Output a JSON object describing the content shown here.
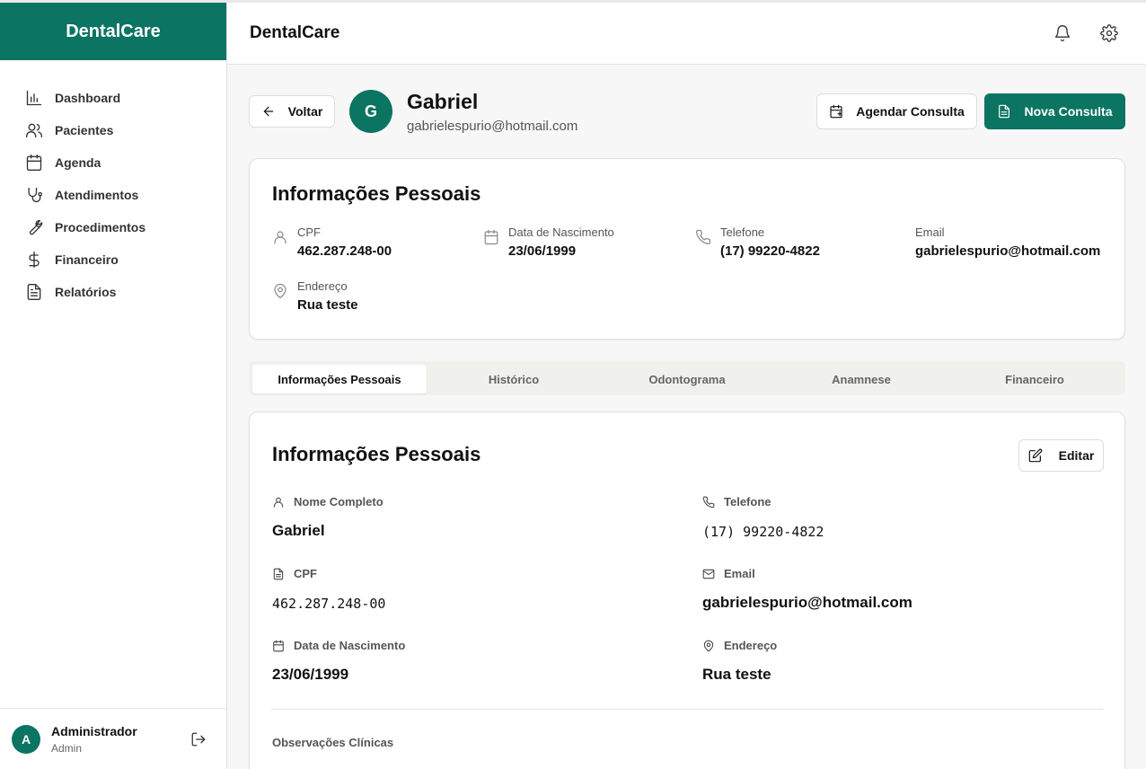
{
  "sidebar": {
    "brand": "DentalCare",
    "items": [
      {
        "label": "Dashboard",
        "icon": "chart-icon"
      },
      {
        "label": "Pacientes",
        "icon": "users-icon"
      },
      {
        "label": "Agenda",
        "icon": "calendar-icon"
      },
      {
        "label": "Atendimentos",
        "icon": "stethoscope-icon"
      },
      {
        "label": "Procedimentos",
        "icon": "wrench-icon"
      },
      {
        "label": "Financeiro",
        "icon": "dollar-icon"
      },
      {
        "label": "Relatórios",
        "icon": "file-icon"
      }
    ],
    "user": {
      "initial": "A",
      "name": "Administrador",
      "role": "Admin"
    }
  },
  "header": {
    "title": "DentalCare"
  },
  "patient": {
    "back_label": "Voltar",
    "initial": "G",
    "name": "Gabriel",
    "email": "gabrielespurio@hotmail.com",
    "schedule_label": "Agendar Consulta",
    "new_label": "Nova Consulta"
  },
  "summary": {
    "title": "Informações Pessoais",
    "fields": {
      "cpf": {
        "label": "CPF",
        "value": "462.287.248-00"
      },
      "birth": {
        "label": "Data de Nascimento",
        "value": "23/06/1999"
      },
      "phone": {
        "label": "Telefone",
        "value": "(17) 99220-4822"
      },
      "email": {
        "label": "Email",
        "value": "gabrielespurio@hotmail.com"
      },
      "address": {
        "label": "Endereço",
        "value": "Rua teste"
      }
    }
  },
  "tabs": [
    "Informações Pessoais",
    "Histórico",
    "Odontograma",
    "Anamnese",
    "Financeiro"
  ],
  "details": {
    "title": "Informações Pessoais",
    "edit_label": "Editar",
    "fields": {
      "name": {
        "label": "Nome Completo",
        "value": "Gabriel"
      },
      "phone": {
        "label": "Telefone",
        "value": "(17) 99220-4822"
      },
      "cpf": {
        "label": "CPF",
        "value": "462.287.248-00"
      },
      "email": {
        "label": "Email",
        "value": "gabrielespurio@hotmail.com"
      },
      "birth": {
        "label": "Data de Nascimento",
        "value": "23/06/1999"
      },
      "address": {
        "label": "Endereço",
        "value": "Rua teste"
      }
    },
    "notes_label": "Observações Clínicas"
  },
  "colors": {
    "brand": "#0b7462"
  }
}
